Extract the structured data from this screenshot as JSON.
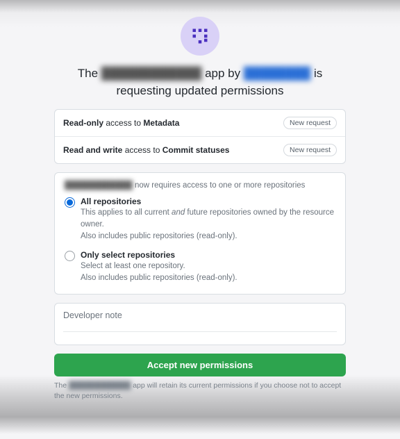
{
  "header": {
    "title_prefix": "The",
    "app_name_redacted": "████████████",
    "title_mid": "app by",
    "author_redacted": "████████",
    "title_suffix": "is requesting updated permissions"
  },
  "permissions": [
    {
      "prefix": "Read-only",
      "middle": "access to",
      "subject": "Metadata",
      "badge": "New request"
    },
    {
      "prefix": "Read and write",
      "middle": "access to",
      "subject": "Commit statuses",
      "badge": "New request"
    }
  ],
  "repos": {
    "intro_redacted": "████████████",
    "intro_suffix": "now requires access to one or more repositories",
    "options": [
      {
        "id": "all",
        "selected": true,
        "title": "All repositories",
        "desc1_a": "This applies to all current ",
        "desc1_it": "and",
        "desc1_b": " future repositories owned by the resource owner.",
        "desc2": "Also includes public repositories (read-only)."
      },
      {
        "id": "select",
        "selected": false,
        "title": "Only select repositories",
        "desc1_a": "Select at least one repository.",
        "desc1_it": "",
        "desc1_b": "",
        "desc2": "Also includes public repositories (read-only)."
      }
    ]
  },
  "devnote": {
    "label": "Developer note"
  },
  "actions": {
    "accept": "Accept new permissions"
  },
  "footnote": {
    "prefix": "The",
    "app_name_redacted": "████████████",
    "suffix": "app will retain its current permissions if you choose not to accept the new permissions."
  }
}
